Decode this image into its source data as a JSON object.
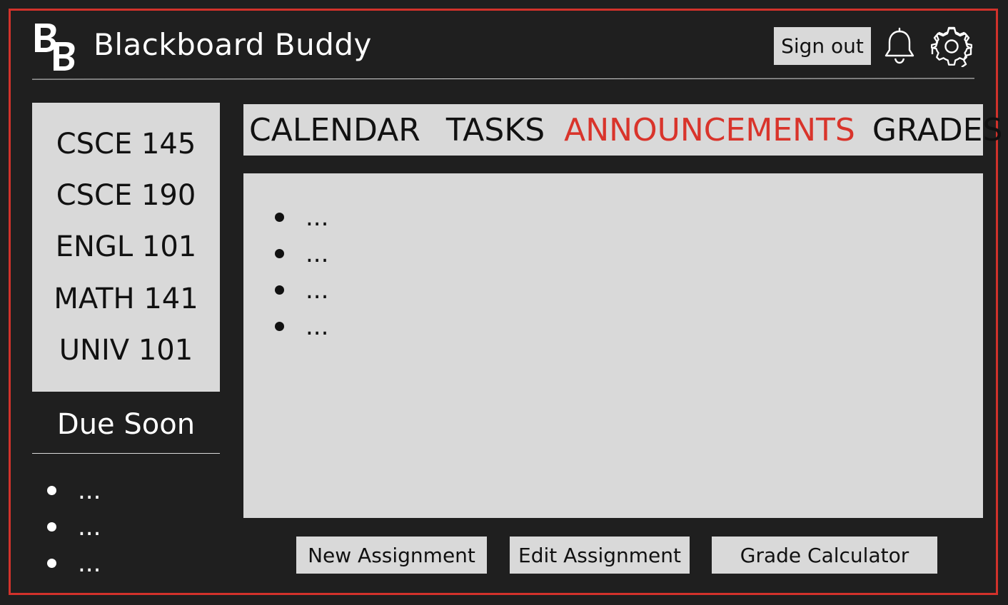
{
  "header": {
    "logo_text": "BB",
    "title": "Blackboard Buddy",
    "signout_label": "Sign out",
    "bell_icon": "bell-icon",
    "settings_icon": "gear-icon"
  },
  "sidebar": {
    "courses": [
      {
        "label": "CSCE 145"
      },
      {
        "label": "CSCE 190"
      },
      {
        "label": "ENGL 101"
      },
      {
        "label": "MATH 141"
      },
      {
        "label": "UNIV 101"
      }
    ],
    "due_soon_title": "Due Soon",
    "due_soon_items": [
      "...",
      "...",
      "..."
    ]
  },
  "tabs": [
    {
      "label": "CALENDAR",
      "active": false
    },
    {
      "label": "TASKS",
      "active": false
    },
    {
      "label": "ANNOUNCEMENTS",
      "active": true
    },
    {
      "label": "GRADES",
      "active": false
    }
  ],
  "announcements": [
    "...",
    "...",
    "...",
    "..."
  ],
  "actions": {
    "new_assignment": "New Assignment",
    "edit_assignment": "Edit Assignment",
    "grade_calculator": "Grade Calculator"
  },
  "colors": {
    "background": "#1f1f1f",
    "accent": "#d9342b",
    "panel": "#d9d9d9"
  }
}
